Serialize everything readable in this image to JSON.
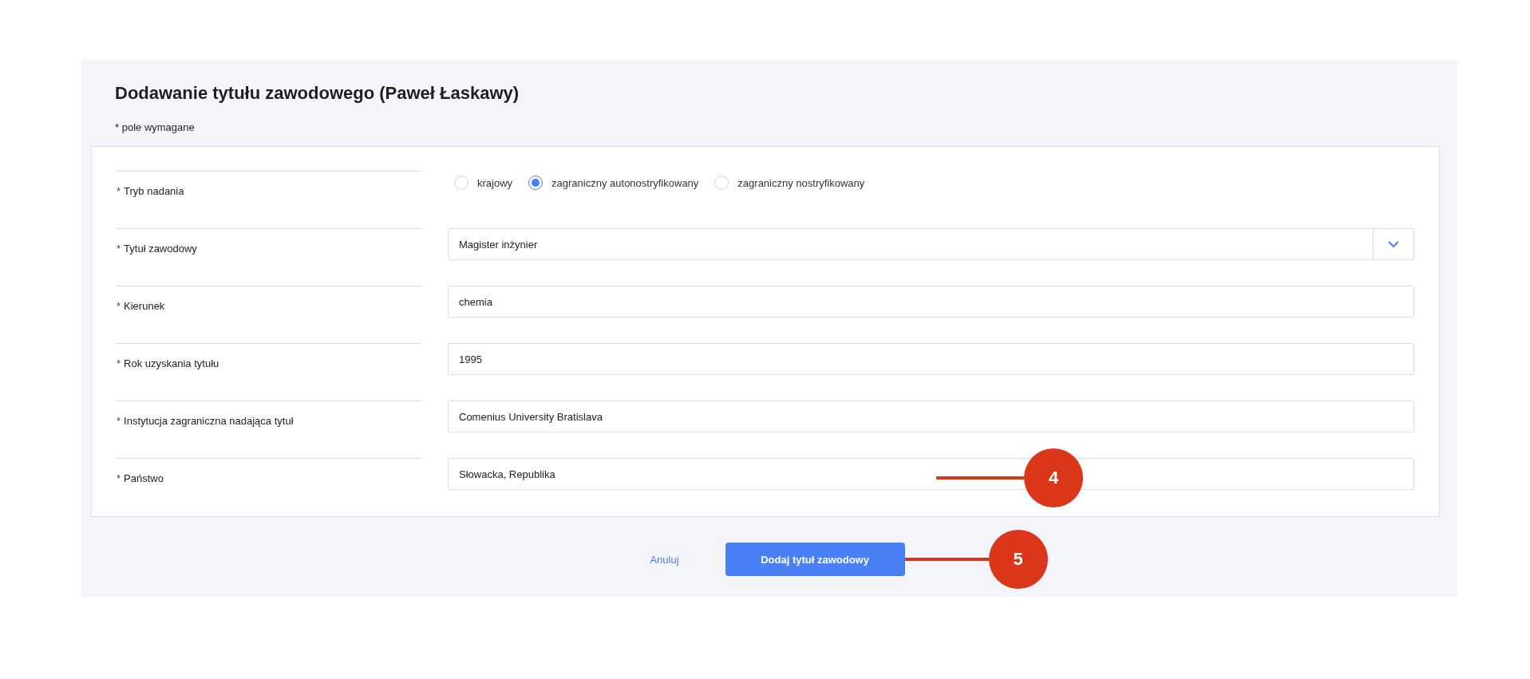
{
  "title": "Dodawanie tytułu zawodowego (Paweł Łaskawy)",
  "required_note": {
    "mark": "*",
    "text": "pole wymagane"
  },
  "fields": [
    {
      "kind": "radio",
      "label": "Tryb nadania",
      "required": true,
      "options": [
        {
          "label": "krajowy",
          "selected": false
        },
        {
          "label": "zagraniczny autonostryfikowany",
          "selected": true
        },
        {
          "label": "zagraniczny nostryfikowany",
          "selected": false
        }
      ]
    },
    {
      "kind": "select",
      "label": "Tytuł zawodowy",
      "required": true,
      "value": "Magister inżynier"
    },
    {
      "kind": "text",
      "label": "Kierunek",
      "required": true,
      "value": "chemia"
    },
    {
      "kind": "text",
      "label": "Rok uzyskania tytułu",
      "required": true,
      "value": "1995"
    },
    {
      "kind": "text",
      "label": "Instytucja zagraniczna nadająca tytuł",
      "required": true,
      "value": "Comenius University Bratislava"
    },
    {
      "kind": "text",
      "label": "Państwo",
      "required": true,
      "value": "Słowacka, Republika",
      "callout": "4"
    }
  ],
  "actions": {
    "cancel": "Anuluj",
    "submit": {
      "label": "Dodaj tytuł zawodowy",
      "callout": "5"
    }
  }
}
